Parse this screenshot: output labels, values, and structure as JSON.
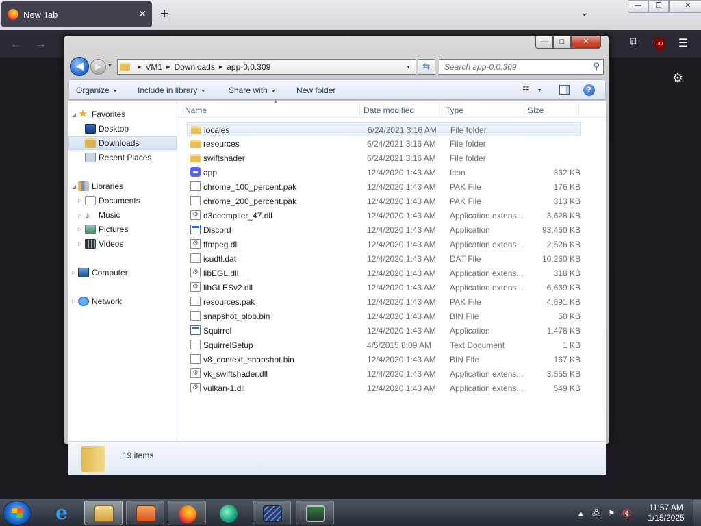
{
  "firefox": {
    "tab_title": "New Tab",
    "tab_close": "✕",
    "new_tab": "+",
    "list_all_tabs": "⌄",
    "window_controls": {
      "minimize": "—",
      "maximize": "❐",
      "close": "✕"
    },
    "nav": {
      "back": "←",
      "forward": "→",
      "extensions": "⧉",
      "ublock": "uO",
      "menu": "☰"
    },
    "settings_icon": "⚙"
  },
  "explorer": {
    "caption": {
      "minimize": "—",
      "maximize": "□",
      "close": "✕"
    },
    "back": "◀",
    "forward": "▶",
    "address": {
      "crumbs": [
        "VM1",
        "Downloads",
        "app-0.0.309"
      ]
    },
    "search_placeholder": "Search app-0.0.309",
    "toolbar": {
      "organize": "Organize",
      "include_in_library": "Include in library",
      "share_with": "Share with",
      "new_folder": "New folder",
      "help": "?"
    },
    "nav_pane": {
      "favorites": "Favorites",
      "desktop": "Desktop",
      "downloads": "Downloads",
      "recent_places": "Recent Places",
      "libraries": "Libraries",
      "documents": "Documents",
      "music": "Music",
      "pictures": "Pictures",
      "videos": "Videos",
      "computer": "Computer",
      "network": "Network"
    },
    "columns": {
      "name": "Name",
      "date": "Date modified",
      "type": "Type",
      "size": "Size"
    },
    "files": [
      {
        "name": "locales",
        "date": "6/24/2021 3:16 AM",
        "type": "File folder",
        "size": "",
        "icon": "folder-icon"
      },
      {
        "name": "resources",
        "date": "6/24/2021 3:16 AM",
        "type": "File folder",
        "size": "",
        "icon": "folder-icon"
      },
      {
        "name": "swiftshader",
        "date": "6/24/2021 3:16 AM",
        "type": "File folder",
        "size": "",
        "icon": "folder-icon"
      },
      {
        "name": "app",
        "date": "12/4/2020 1:43 AM",
        "type": "Icon",
        "size": "362 KB",
        "icon": "discord-icon"
      },
      {
        "name": "chrome_100_percent.pak",
        "date": "12/4/2020 1:43 AM",
        "type": "PAK File",
        "size": "176 KB",
        "icon": "file-icon"
      },
      {
        "name": "chrome_200_percent.pak",
        "date": "12/4/2020 1:43 AM",
        "type": "PAK File",
        "size": "313 KB",
        "icon": "file-icon"
      },
      {
        "name": "d3dcompiler_47.dll",
        "date": "12/4/2020 1:43 AM",
        "type": "Application extens...",
        "size": "3,628 KB",
        "icon": "dll-icon"
      },
      {
        "name": "Discord",
        "date": "12/4/2020 1:43 AM",
        "type": "Application",
        "size": "93,460 KB",
        "icon": "application-icon"
      },
      {
        "name": "ffmpeg.dll",
        "date": "12/4/2020 1:43 AM",
        "type": "Application extens...",
        "size": "2,526 KB",
        "icon": "dll-icon"
      },
      {
        "name": "icudtl.dat",
        "date": "12/4/2020 1:43 AM",
        "type": "DAT File",
        "size": "10,260 KB",
        "icon": "file-icon"
      },
      {
        "name": "libEGL.dll",
        "date": "12/4/2020 1:43 AM",
        "type": "Application extens...",
        "size": "318 KB",
        "icon": "dll-icon"
      },
      {
        "name": "libGLESv2.dll",
        "date": "12/4/2020 1:43 AM",
        "type": "Application extens...",
        "size": "6,669 KB",
        "icon": "dll-icon"
      },
      {
        "name": "resources.pak",
        "date": "12/4/2020 1:43 AM",
        "type": "PAK File",
        "size": "4,691 KB",
        "icon": "file-icon"
      },
      {
        "name": "snapshot_blob.bin",
        "date": "12/4/2020 1:43 AM",
        "type": "BIN File",
        "size": "50 KB",
        "icon": "file-icon"
      },
      {
        "name": "Squirrel",
        "date": "12/4/2020 1:43 AM",
        "type": "Application",
        "size": "1,478 KB",
        "icon": "application-icon"
      },
      {
        "name": "SquirrelSetup",
        "date": "4/5/2015 8:09 AM",
        "type": "Text Document",
        "size": "1 KB",
        "icon": "file-icon"
      },
      {
        "name": "v8_context_snapshot.bin",
        "date": "12/4/2020 1:43 AM",
        "type": "BIN File",
        "size": "167 KB",
        "icon": "file-icon"
      },
      {
        "name": "vk_swiftshader.dll",
        "date": "12/4/2020 1:43 AM",
        "type": "Application extens...",
        "size": "3,555 KB",
        "icon": "dll-icon"
      },
      {
        "name": "vulkan-1.dll",
        "date": "12/4/2020 1:43 AM",
        "type": "Application extens...",
        "size": "549 KB",
        "icon": "dll-icon"
      }
    ],
    "status": "19 items"
  },
  "taskbar": {
    "tray": {
      "up_arrow": "▲",
      "network": "🖧",
      "action_center": "⚑",
      "volume": "🔇"
    },
    "clock": {
      "time": "11:57 AM",
      "date": "1/15/2025"
    }
  }
}
